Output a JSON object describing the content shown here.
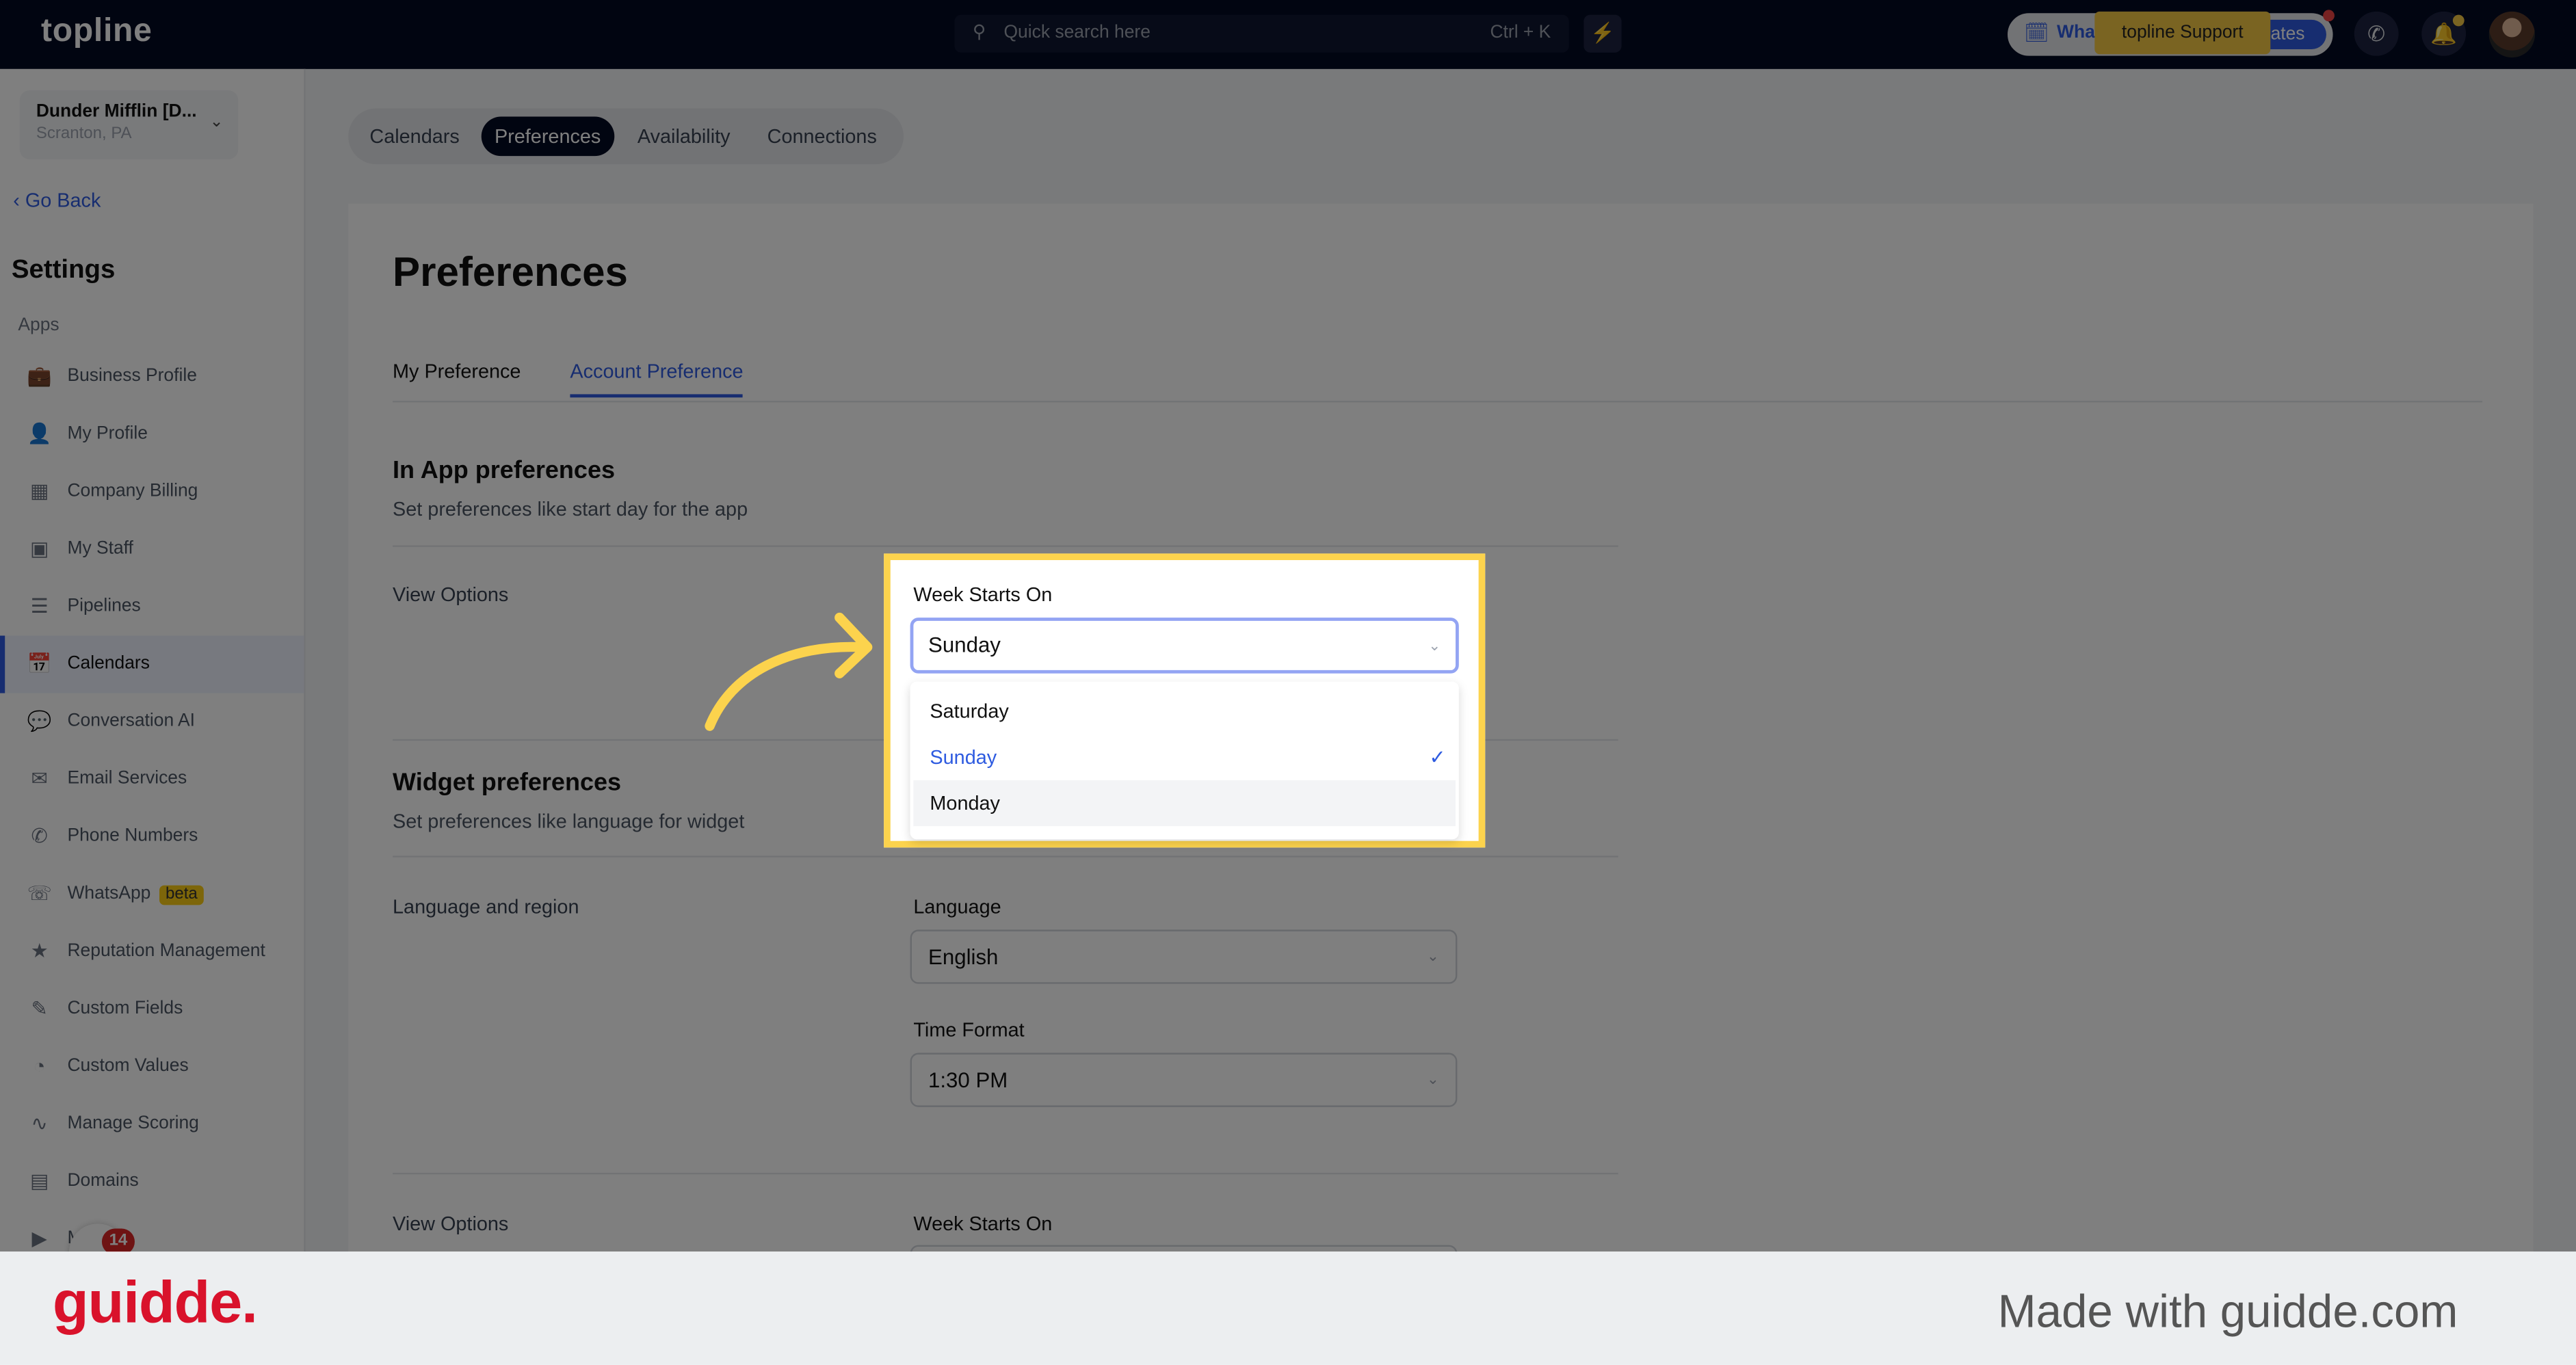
{
  "topbar": {
    "logo": "topline",
    "search_placeholder": "Quick search here",
    "search_shortcut": "Ctrl + K",
    "whats_new": "What's new",
    "updates": "dates",
    "support_tooltip": "topline Support"
  },
  "sidebar": {
    "account_name": "Dunder Mifflin [D...",
    "account_location": "Scranton, PA",
    "go_back": "Go Back",
    "title": "Settings",
    "section": "Apps",
    "items": [
      {
        "label": "Business Profile",
        "icon": "briefcase-icon"
      },
      {
        "label": "My Profile",
        "icon": "person-icon"
      },
      {
        "label": "Company Billing",
        "icon": "grid-icon"
      },
      {
        "label": "My Staff",
        "icon": "staff-icon"
      },
      {
        "label": "Pipelines",
        "icon": "filter-icon"
      },
      {
        "label": "Calendars",
        "icon": "calendar-icon",
        "active": true
      },
      {
        "label": "Conversation AI",
        "icon": "chat-icon"
      },
      {
        "label": "Email Services",
        "icon": "mail-icon"
      },
      {
        "label": "Phone Numbers",
        "icon": "phone-icon"
      },
      {
        "label": "WhatsApp",
        "icon": "whatsapp-icon",
        "badge": "beta"
      },
      {
        "label": "Reputation Management",
        "icon": "star-icon"
      },
      {
        "label": "Custom Fields",
        "icon": "edit-icon"
      },
      {
        "label": "Custom Values",
        "icon": "pie-icon"
      },
      {
        "label": "Manage Scoring",
        "icon": "chart-icon"
      },
      {
        "label": "Domains",
        "icon": "window-icon"
      },
      {
        "label": "Media",
        "icon": "video-icon"
      }
    ],
    "chat_badge": "14"
  },
  "tabs": [
    "Calendars",
    "Preferences",
    "Availability",
    "Connections"
  ],
  "page": {
    "title": "Preferences",
    "subtabs": [
      "My Preference",
      "Account Preference"
    ],
    "in_app": {
      "title": "In App preferences",
      "desc": "Set preferences like start day for the app",
      "view_options": "View Options"
    },
    "week_starts": {
      "label": "Week Starts On",
      "value": "Sunday",
      "options": [
        "Saturday",
        "Sunday",
        "Monday"
      ]
    },
    "widget": {
      "title": "Widget preferences",
      "desc": "Set preferences like language for widget",
      "lang_region": "Language and region",
      "language_label": "Language",
      "language_value": "English",
      "time_format_label": "Time Format",
      "time_format_value": "1:30 PM",
      "view_options": "View Options",
      "week_starts_label": "Week Starts On"
    }
  },
  "footer": {
    "logo": "guidde.",
    "made_with": "Made with guidde.com"
  },
  "colors": {
    "accent": "#2e5be0",
    "topbar": "#030a22",
    "highlight": "#fcd34d",
    "brand_red": "#d9122b"
  }
}
